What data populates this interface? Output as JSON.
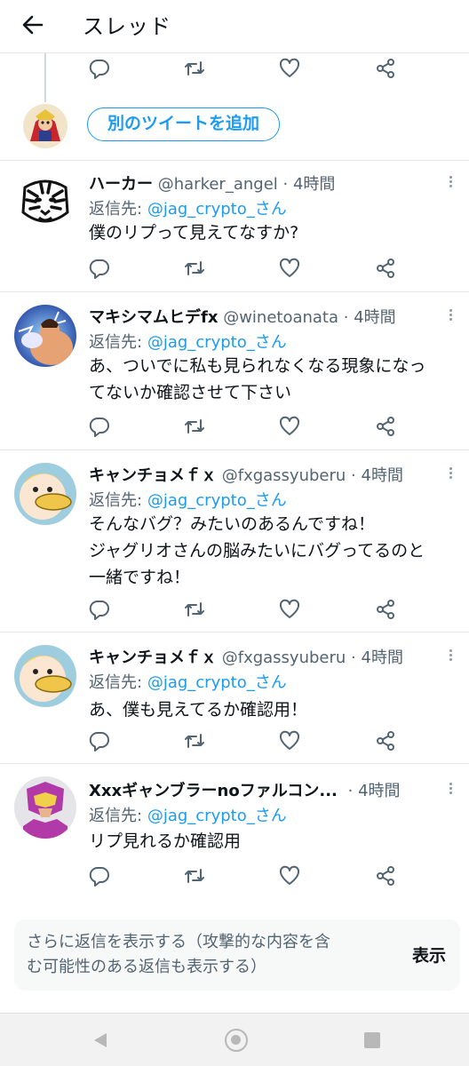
{
  "header": {
    "title": "スレッド"
  },
  "add_tweet": {
    "label": "別のツイートを追加"
  },
  "reply_prefix": "返信先:",
  "tweets": [
    {
      "name": "ハーカー",
      "handle": "@harker_angel",
      "time": "· 4時間",
      "reply_to": "@jag_crypto_さん",
      "lines": [
        "僕のリプって見えてなすか?"
      ]
    },
    {
      "name": "マキシマムヒデfx",
      "handle": "@winetoanata",
      "time": "· 4時間",
      "reply_to": "@jag_crypto_さん",
      "lines": [
        "あ、ついでに私も見られなくなる現象になっ",
        "てないか確認させて下さい"
      ]
    },
    {
      "name": "キャンチョメｆｘ",
      "handle": "@fxgassyuberu",
      "time": "· 4時間",
      "reply_to": "@jag_crypto_さん",
      "lines": [
        "そんなバグ？みたいのあるんですね！",
        "ジャグリオさんの脳みたいにバグってるのと",
        "一緒ですね！"
      ]
    },
    {
      "name": "キャンチョメｆｘ",
      "handle": "@fxgassyuberu",
      "time": "· 4時間",
      "reply_to": "@jag_crypto_さん",
      "lines": [
        "あ、僕も見えてるか確認用！"
      ]
    },
    {
      "name": "Xxxギャンブラーnoファルコン...",
      "handle": "",
      "time": "· 4時間",
      "reply_to": "@jag_crypto_さん",
      "lines": [
        "リプ見れるか確認用"
      ]
    }
  ],
  "more_replies": {
    "text_line1": "さらに返信を表示する（攻撃的な内容を含",
    "text_line2": "む可能性のある返信も表示する）",
    "button": "表示"
  },
  "colors": {
    "accent": "#1d9bf0",
    "icon_gray": "#536471"
  },
  "icons": [
    "back-arrow-icon",
    "reply-icon",
    "retweet-icon",
    "like-icon",
    "share-icon",
    "more-icon"
  ]
}
